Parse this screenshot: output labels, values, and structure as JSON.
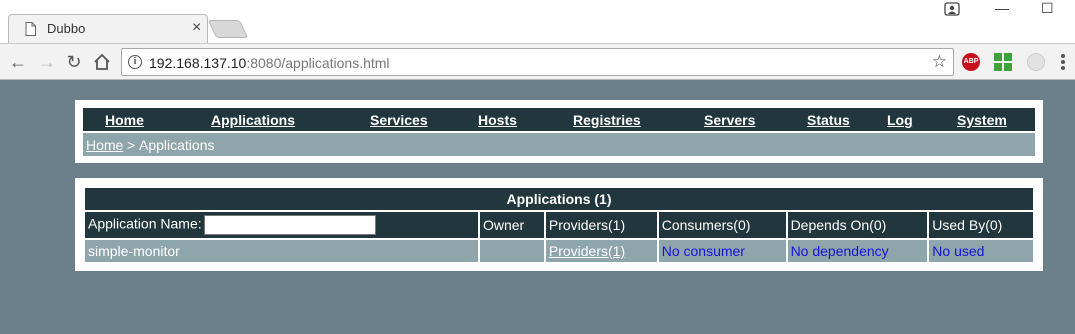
{
  "browser": {
    "tab_title": "Dubbo",
    "tab_close": "×",
    "url_host": "192.168.137.10",
    "url_port": ":8080",
    "url_path": "/applications.html",
    "abp_label": "ABP",
    "window_minimize": "—",
    "window_maximize": "☐"
  },
  "nav": {
    "home": "Home",
    "applications": "Applications",
    "services": "Services",
    "hosts": "Hosts",
    "registries": "Registries",
    "servers": "Servers",
    "status": "Status",
    "log": "Log",
    "system": "System"
  },
  "breadcrumb": {
    "home": "Home",
    "separator": " > ",
    "current": "Applications"
  },
  "apps_table": {
    "caption": "Applications (1)",
    "headers": {
      "app_name": "Application Name:",
      "owner": "Owner",
      "providers": "Providers(1)",
      "consumers": "Consumers(0)",
      "depends_on": "Depends On(0)",
      "used_by": "Used By(0)"
    },
    "filter_value": "",
    "rows": [
      {
        "name": "simple-monitor",
        "owner": "",
        "providers": "Providers(1)",
        "consumers": "No consumer",
        "depends_on": "No dependency",
        "used_by": "No used"
      }
    ]
  },
  "colors": {
    "page_bg": "#6b808a",
    "dark_header": "#22363e",
    "row_bg": "#8ea5ac",
    "link_blue": "#1515d8"
  }
}
